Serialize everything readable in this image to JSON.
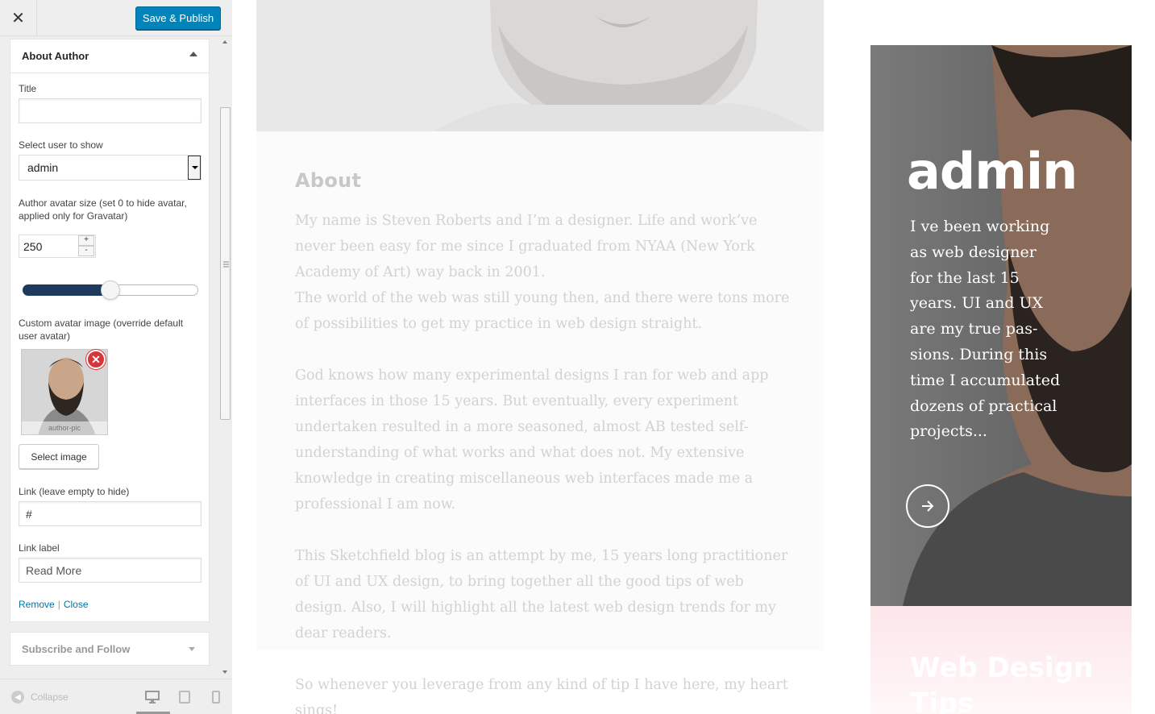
{
  "topbar": {
    "close_symbol": "✕",
    "publish_label": "Save & Publish"
  },
  "widget": {
    "title": "About Author",
    "title_label": "Title",
    "title_value": "",
    "user_label": "Select user to show",
    "user_value": "admin",
    "avatar_size_label": "Author avatar size (set 0 to hide avatar, applied only for Gravatar)",
    "avatar_size_value": "250",
    "avatar_slider_fraction": 0.5,
    "custom_avatar_label": "Custom avatar image (override default user avatar)",
    "avatar_caption": "author-pic",
    "select_image_label": "Select image",
    "link_label": "Link (leave empty to hide)",
    "link_value": "#",
    "link_text_label": "Link label",
    "link_text_value": "Read More",
    "remove_label": "Remove",
    "separator": "|",
    "close_label": "Close"
  },
  "widget2": {
    "title": "Subscribe and Follow"
  },
  "footer": {
    "collapse_label": "Collapse"
  },
  "preview": {
    "about_heading": "About",
    "paragraphs": [
      "My name is Steven Roberts and I’m a designer. Life and work’ve never been easy for me since I graduated from NYAA (New York Academy of Art) way back in 2001.",
      "The world of the web was still young then, and there were tons more of possibilities to get my practice in web design straight.",
      "God knows how many experimental designs I ran for web and app interfaces in those 15 years. But eventually, every experi­ment undertaken resulted in a more seasoned, almost AB tested self-understanding of what works and what does not. My exten­sive knowledge in creating miscellaneous web interfaces made me a professional I am now.",
      "This Sketchfield blog is an attempt by me, 15 years long practi­tioner of UI and UX design, to bring together all the good tips of web design. Also, I will highlight all the latest web design trends for my dear readers.",
      "So whenever you leverage from any kind of tip I have here, my heart sings!"
    ],
    "card_name": "admin",
    "card_bio": "I ve been working as web designer for the last 15 years. UI and UX are my true pas­sions. During this time I accumulated dozens of practical projects...",
    "card2_title": "Web De­sign Tips"
  },
  "colors": {
    "accent": "#0085ba",
    "slider": "#1c3a5e",
    "link": "#0073aa",
    "remove": "#d63638"
  }
}
